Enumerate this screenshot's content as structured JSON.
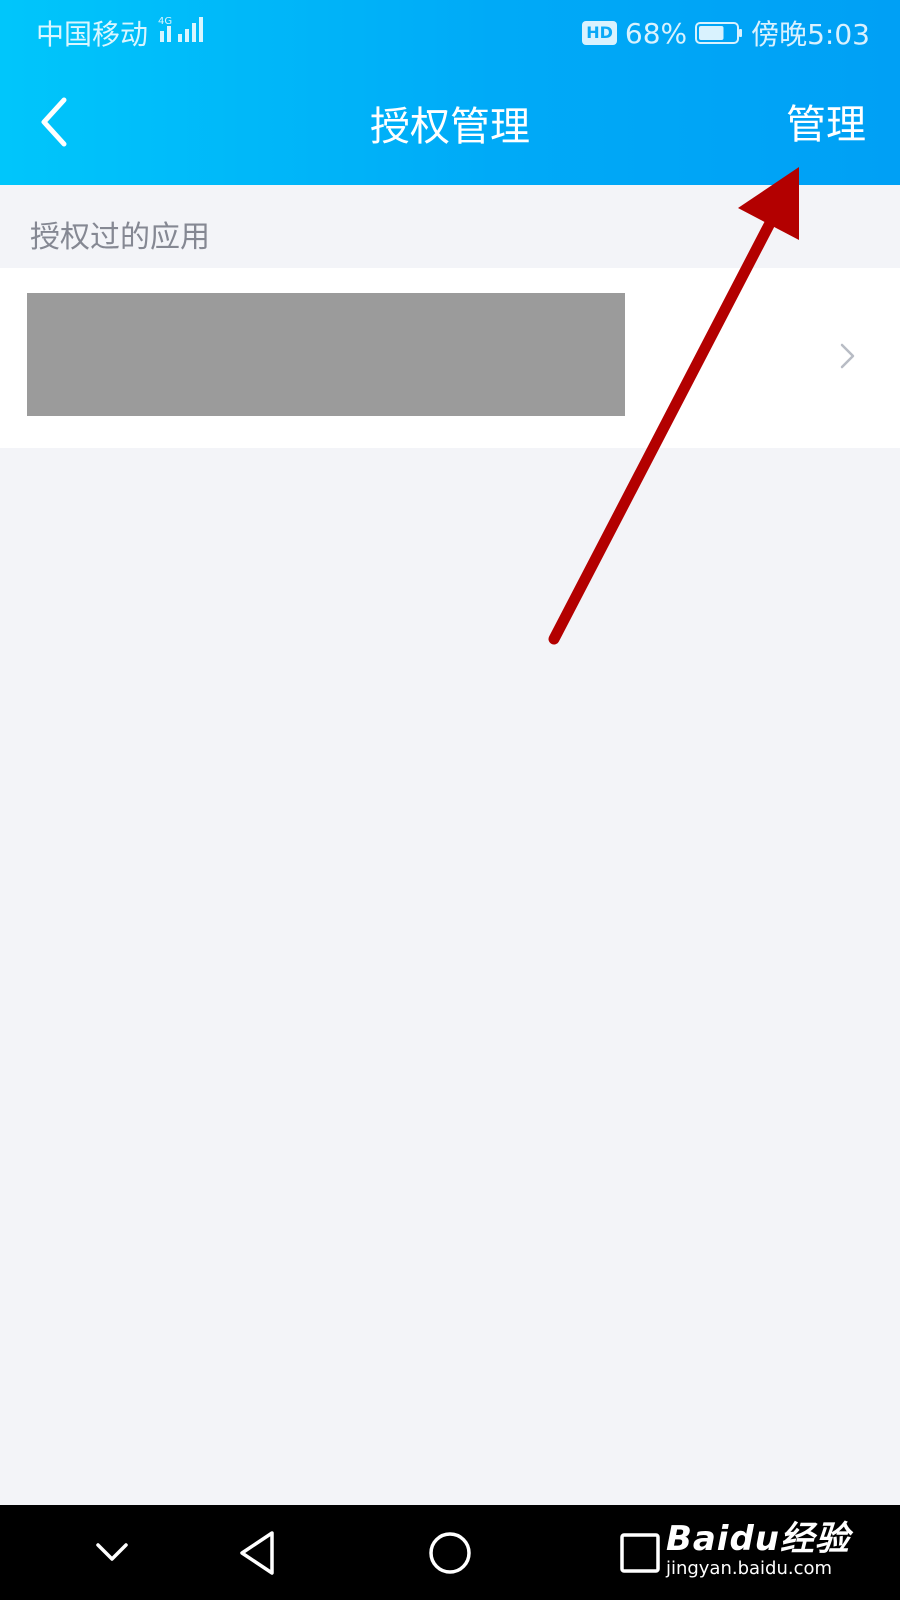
{
  "status_bar": {
    "carrier": "中国移动",
    "network": "4G",
    "hd": "HD",
    "battery_percent": "68%",
    "battery_level": 0.68,
    "time": "傍晚5:03"
  },
  "header": {
    "title": "授权管理",
    "manage_label": "管理"
  },
  "section": {
    "label": "授权过的应用"
  },
  "apps": [
    {
      "name": ""
    }
  ],
  "annotation": {
    "color": "#b30000"
  },
  "colors": {
    "header_start": "#00c6fb",
    "header_end": "#00a0f5",
    "background": "#f3f4f8"
  },
  "system_nav": {
    "keys": [
      "hide-keyboard-icon",
      "back-triangle-icon",
      "home-circle-icon",
      "recents-square-icon"
    ]
  },
  "watermark": {
    "logo": "Baidu经验",
    "url": "jingyan.baidu.com"
  }
}
